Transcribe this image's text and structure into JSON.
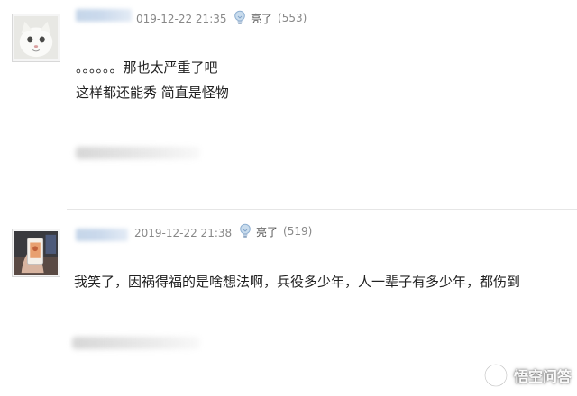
{
  "comments": [
    {
      "time": "019-12-22 21:35",
      "like_label": "亮了",
      "like_count": "(553)",
      "lines": [
        "。。。。。。那也太严重了吧",
        "这样都还能秀 简直是怪物"
      ]
    },
    {
      "time": "2019-12-22 21:38",
      "like_label": "亮了",
      "like_count": "(519)",
      "lines": [
        "我笑了，因祸得福的是啥想法啊，兵役多少年，人一辈子有多少年，都伤到"
      ]
    }
  ],
  "watermark": {
    "text": "悟空问答"
  },
  "colors": {
    "time": "#888888",
    "body_text": "#222222",
    "bulb": "#9ab6d6",
    "divider": "#e6e6e6"
  },
  "icons": {
    "like": "lightbulb-icon",
    "watermark": "wukong-logo-icon"
  }
}
